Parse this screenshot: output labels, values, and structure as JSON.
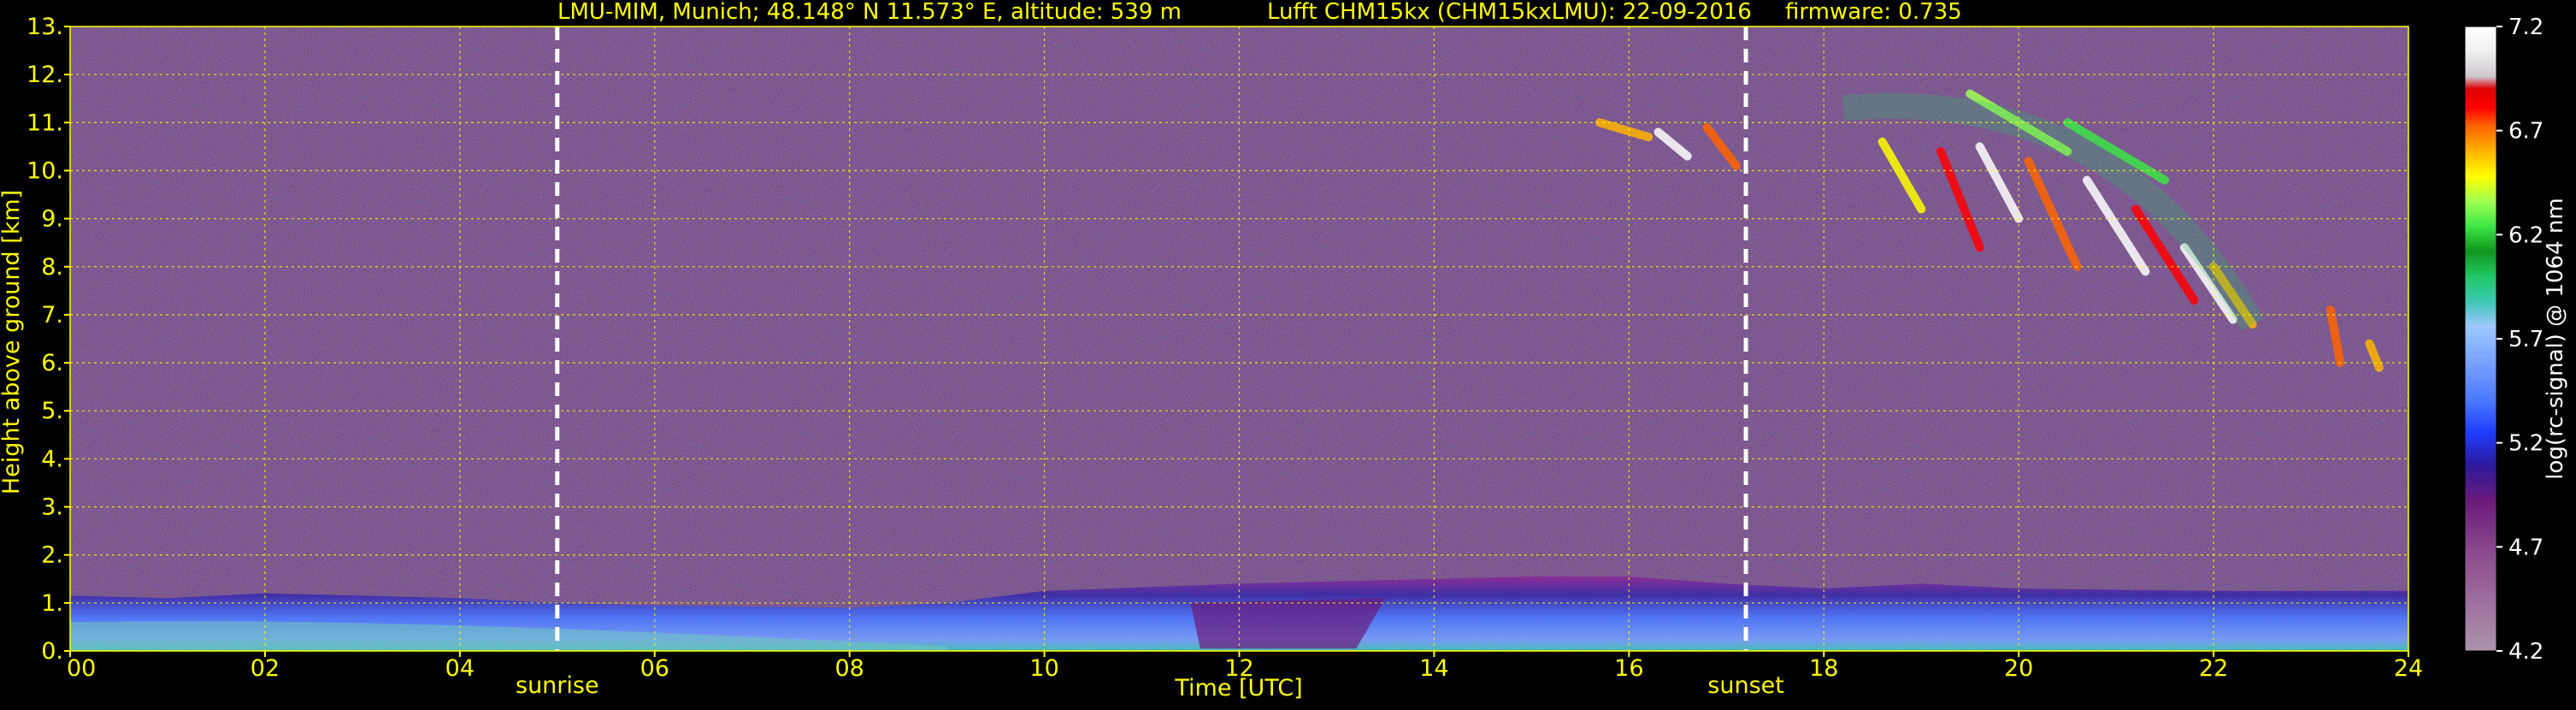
{
  "header": {
    "site": "LMU-MIM, Munich; 48.148° N 11.573° E, altitude: 539 m",
    "instrument": "Lufft CHM15kx (CHM15kxLMU): 22-09-2016",
    "firmware": "firmware: 0.735"
  },
  "colors": {
    "text": "#ffff00",
    "grid": "#ffff00",
    "background": "#000000",
    "noise_base": "#4a3355",
    "boundary_layer_top": "#8a2a96",
    "marker": "#ffffff"
  },
  "chart_data": {
    "type": "heatmap",
    "title": "LMU-MIM, Munich; 48.148° N 11.573° E, altitude: 539 m    Lufft CHM15kx (CHM15kxLMU): 22-09-2016    firmware: 0.735",
    "xlabel": "Time [UTC]",
    "ylabel": "Height above ground [km]",
    "colorbar_label": "log(rc-signal) @ 1064 nm",
    "xlim": [
      0,
      24
    ],
    "ylim": [
      0,
      13
    ],
    "x_ticks": [
      "00",
      "02",
      "04",
      "06",
      "08",
      "10",
      "12",
      "14",
      "16",
      "18",
      "20",
      "22",
      "24"
    ],
    "y_ticks": [
      "0.",
      "1.",
      "2.",
      "3.",
      "4.",
      "5.",
      "6.",
      "7.",
      "8.",
      "9.",
      "10.",
      "11.",
      "12.",
      "13."
    ],
    "colorbar_range": [
      4.2,
      7.2
    ],
    "colorbar_ticks": [
      "4.2",
      "4.7",
      "5.2",
      "5.7",
      "6.2",
      "6.7",
      "7.2"
    ],
    "grid": true,
    "markers": [
      {
        "label": "sunrise",
        "time": 5.0
      },
      {
        "label": "sunset",
        "time": 17.2
      }
    ],
    "colorscale": [
      "#aa94a8",
      "#9e6e9e",
      "#8a4a8e",
      "#6a1a7a",
      "#2a1aa0",
      "#1e3cff",
      "#4a78ff",
      "#78a0ff",
      "#9ec8ff",
      "#3cc8b4",
      "#20c864",
      "#10961e",
      "#3ce646",
      "#a0ff50",
      "#ffff00",
      "#ffb400",
      "#ff6400",
      "#ff0000",
      "#dc0000",
      "#d0c8d0",
      "#f0f0f0",
      "#ffffff"
    ]
  }
}
